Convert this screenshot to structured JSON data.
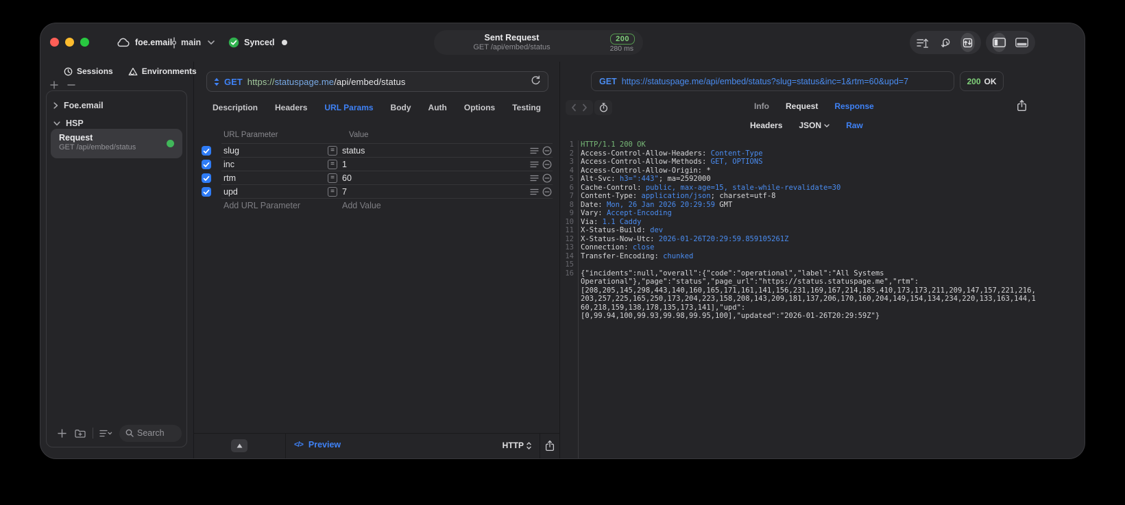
{
  "colors": {
    "accent_blue": "#3f82f6",
    "code_value_blue": "#4a8cf0",
    "status_green": "#80d17a",
    "checkbox_blue": "#2f7cf6",
    "selected_row_bg": "#3a3a3e"
  },
  "titlebar": {
    "project": "foe.email",
    "branch": "main",
    "sync": "Synced",
    "center": {
      "title": "Sent Request",
      "subtitle": "GET /api/embed/status",
      "status_code": "200",
      "time": "280 ms"
    }
  },
  "sidebar": {
    "tab_sessions": "Sessions",
    "tab_environments": "Environments",
    "group_collapsed": "Foe.email",
    "group_expanded": "HSP",
    "request": {
      "title": "Request",
      "subtitle": "GET /api/embed/status"
    },
    "search_placeholder": "Search"
  },
  "request_pane": {
    "method": "GET",
    "url": {
      "scheme": "https://",
      "host": "statuspage.me",
      "path": "/api/embed/status"
    },
    "tabs": [
      "Description",
      "Headers",
      "URL Params",
      "Body",
      "Auth",
      "Options",
      "Testing"
    ],
    "active_tab": "URL Params",
    "params": {
      "header_name": "URL Parameter",
      "header_value": "Value",
      "equals_glyph": "=",
      "rows": [
        {
          "name": "slug",
          "value": "status",
          "enabled": true
        },
        {
          "name": "inc",
          "value": "1",
          "enabled": true
        },
        {
          "name": "rtm",
          "value": "60",
          "enabled": true
        },
        {
          "name": "upd",
          "value": "7",
          "enabled": true
        }
      ],
      "add_name": "Add URL Parameter",
      "add_value": "Add Value"
    },
    "footer": {
      "code_glyph": "</>",
      "preview": "Preview",
      "protocol": "HTTP"
    }
  },
  "response_pane": {
    "method": "GET",
    "url": "https://statuspage.me/api/embed/status?slug=status&inc=1&rtm=60&upd=7",
    "status_code": "200",
    "status_text": "OK",
    "tabs": [
      "Info",
      "Request",
      "Response"
    ],
    "active_tab": "Response",
    "subtab_headers": "Headers",
    "subtab_json": "JSON",
    "subtab_raw": "Raw",
    "active_subtab": "Raw",
    "code": {
      "lines": [
        {
          "n": "1",
          "segs": [
            {
              "c": "g",
              "t": "HTTP/1.1 200 OK"
            }
          ]
        },
        {
          "n": "2",
          "segs": [
            {
              "c": "w",
              "t": "Access-Control-Allow-Headers: "
            },
            {
              "c": "b",
              "t": "Content-Type"
            }
          ]
        },
        {
          "n": "3",
          "segs": [
            {
              "c": "w",
              "t": "Access-Control-Allow-Methods: "
            },
            {
              "c": "b",
              "t": "GET, OPTIONS"
            }
          ]
        },
        {
          "n": "4",
          "segs": [
            {
              "c": "w",
              "t": "Access-Control-Allow-Origin: "
            },
            {
              "c": "w",
              "t": "*"
            }
          ]
        },
        {
          "n": "5",
          "segs": [
            {
              "c": "w",
              "t": "Alt-Svc: "
            },
            {
              "c": "b",
              "t": "h3=\":443\""
            },
            {
              "c": "w",
              "t": "; ma=2592000"
            }
          ]
        },
        {
          "n": "6",
          "segs": [
            {
              "c": "w",
              "t": "Cache-Control: "
            },
            {
              "c": "b",
              "t": "public, max-age=15, stale-while-revalidate=30"
            }
          ]
        },
        {
          "n": "7",
          "segs": [
            {
              "c": "w",
              "t": "Content-Type: "
            },
            {
              "c": "b",
              "t": "application/json"
            },
            {
              "c": "w",
              "t": "; charset=utf-8"
            }
          ]
        },
        {
          "n": "8",
          "segs": [
            {
              "c": "w",
              "t": "Date: "
            },
            {
              "c": "b",
              "t": "Mon, 26 Jan 2026 20:29:59"
            },
            {
              "c": "w",
              "t": " GMT"
            }
          ]
        },
        {
          "n": "9",
          "segs": [
            {
              "c": "w",
              "t": "Vary: "
            },
            {
              "c": "b",
              "t": "Accept-Encoding"
            }
          ]
        },
        {
          "n": "10",
          "segs": [
            {
              "c": "w",
              "t": "Via: "
            },
            {
              "c": "b",
              "t": "1.1 Caddy"
            }
          ]
        },
        {
          "n": "11",
          "segs": [
            {
              "c": "w",
              "t": "X-Status-Build: "
            },
            {
              "c": "b",
              "t": "dev"
            }
          ]
        },
        {
          "n": "12",
          "segs": [
            {
              "c": "w",
              "t": "X-Status-Now-Utc: "
            },
            {
              "c": "b",
              "t": "2026-01-26T20:29:59.859105261Z"
            }
          ]
        },
        {
          "n": "13",
          "segs": [
            {
              "c": "w",
              "t": "Connection: "
            },
            {
              "c": "b",
              "t": "close"
            }
          ]
        },
        {
          "n": "14",
          "segs": [
            {
              "c": "w",
              "t": "Transfer-Encoding: "
            },
            {
              "c": "b",
              "t": "chunked"
            }
          ]
        },
        {
          "n": "15",
          "segs": []
        },
        {
          "n": "16",
          "wrap": [
            "{\"incidents\":null,\"overall\":{\"code\":\"operational\",\"label\":\"All Systems",
            "Operational\"},\"page\":\"status\",\"page_url\":\"https://status.statuspage.me\",\"rtm\":",
            "[208,205,145,298,443,140,160,165,171,161,141,156,231,169,167,214,185,410,173,173,211,209,147,157,221,216,",
            "203,257,225,165,250,173,204,223,158,208,143,209,181,137,206,170,160,204,149,154,134,234,220,133,163,144,1",
            "60,218,159,138,178,135,173,141],\"upd\":",
            "[0,99.94,100,99.93,99.98,99.95,100],\"updated\":\"2026-01-26T20:29:59Z\"}"
          ]
        }
      ]
    }
  }
}
